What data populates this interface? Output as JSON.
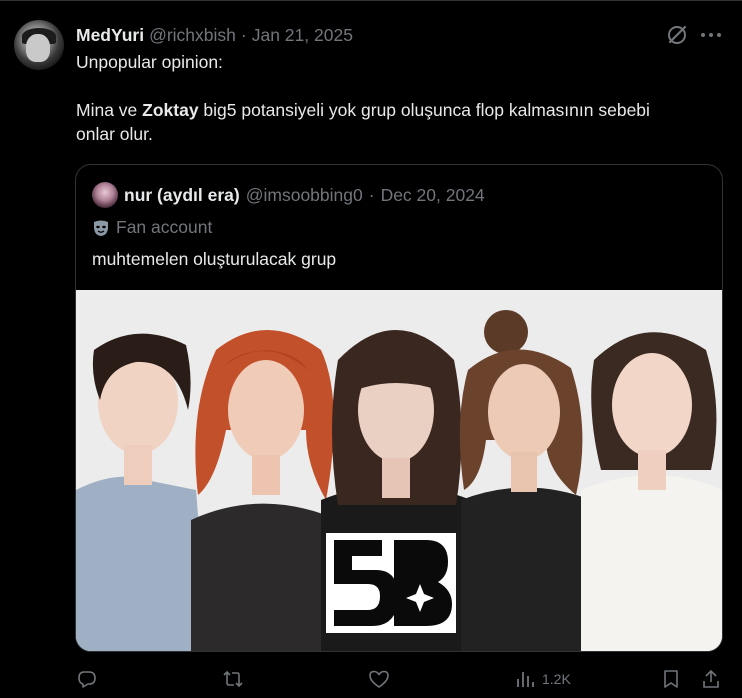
{
  "author": {
    "display_name": "MedYuri",
    "handle": "@richxbish",
    "separator": "·",
    "date": "Jan 21, 2025"
  },
  "tweet": {
    "line1": "Unpopular opinion:",
    "line2_pre": "Mina ve ",
    "line2_bold": "Zoktay",
    "line2_post": " big5 potansiyeli yok grup oluşunca flop kalmasının sebebi",
    "line3": "onlar olur."
  },
  "quote": {
    "display_name": "nur (aydıl era)",
    "handle": "@imsoobbing0",
    "separator": "·",
    "date": "Dec 20, 2024",
    "account_label": "Fan account",
    "text": "muhtemelen oluşturulacak grup"
  },
  "actions": {
    "views_count": "1.2K"
  },
  "icons": [
    "grok-icon",
    "more-icon",
    "mask-icon",
    "reply-icon",
    "retweet-icon",
    "like-icon",
    "views-icon",
    "bookmark-icon",
    "share-icon"
  ],
  "colors": {
    "background": "#000000",
    "text_primary": "#e7e9ea",
    "text_muted": "#71767b",
    "border": "#2f3336"
  }
}
